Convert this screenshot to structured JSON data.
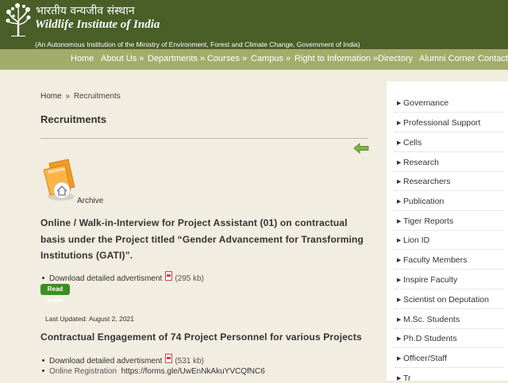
{
  "header": {
    "hindi_title": "भारतीय वन्यजीव संस्थान",
    "site_name": "Wildlife Institute of India",
    "subtitle": "(An Autonomous Institution of the Ministry of Environment, Forest and Climate Change, Government of India)"
  },
  "nav": {
    "items": [
      "Home",
      "About Us »",
      "Departments »",
      "Courses »",
      "Campus »",
      "Right to Information »",
      "Directory",
      "Alumni Corner",
      "Contact U"
    ]
  },
  "breadcrumb": {
    "home": "Home",
    "separator": "»",
    "current": "Recruitments"
  },
  "page_title": "Recruitments",
  "archive": {
    "icon_text": "Archive",
    "label": "Archive"
  },
  "posts": [
    {
      "title": "Online / Walk-in-Interview for Project Assistant (01) on contractual basis under the Project titled “Gender Advancement for Transforming Institutions (GATI)”.",
      "download_label": "Download detailed advertisment",
      "file_size": "(295 kb)",
      "read_more": "Read more"
    },
    {
      "last_updated": "Last Updated: August 2, 2021",
      "title": "Contractual Engagement of 74 Project Personnel for various Projects",
      "download_label": "Download detailed advertisment",
      "file_size": "(531 kb)",
      "registration_label": "Online Registration",
      "registration_link": "https://forms.gle/UwEnNkAkuYVCQfNC6"
    }
  ],
  "sidebar": {
    "items": [
      "Governance",
      "Professional Support",
      "Cells",
      "Research",
      "Researchers",
      "Publication",
      "Tiger Reports",
      "Lion ID",
      "Faculty Members",
      "Inspire Faculty",
      "Scientist on Deputation",
      "M.Sc. Students",
      "Ph.D Students",
      "Officer/Staff",
      "Tr"
    ]
  },
  "colors": {
    "header_bg": "#4a5e28",
    "nav_bg": "#a2ad6b",
    "page_bg": "#f1ede0",
    "read_more_bg": "#3b8f22"
  }
}
